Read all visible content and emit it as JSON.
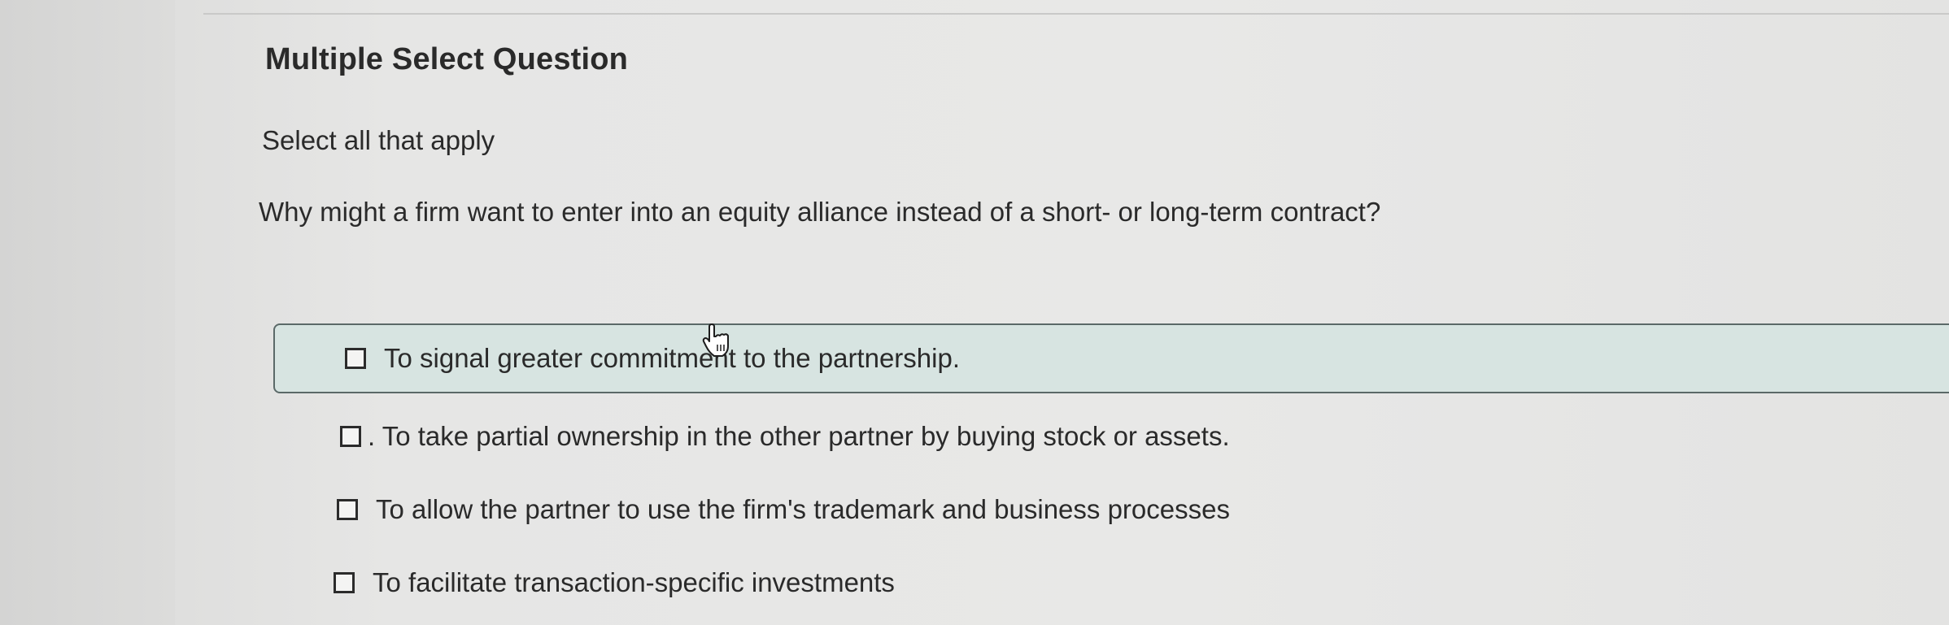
{
  "header": {
    "title": "Multiple Select Question"
  },
  "instruction": "Select all that apply",
  "question": "Why might a firm want to enter into an equity alliance instead of a short- or long-term contract?",
  "options": [
    {
      "label": "To signal greater commitment to the partnership.",
      "checked": false,
      "hovered": true
    },
    {
      "label": ". To take partial ownership in the other partner by buying stock or assets.",
      "checked": false,
      "hovered": false
    },
    {
      "label": "To allow the partner to use the firm's trademark and business processes",
      "checked": false,
      "hovered": false
    },
    {
      "label": "To facilitate transaction-specific investments",
      "checked": false,
      "hovered": false
    }
  ],
  "colors": {
    "highlight_bg": "#d7e4e1",
    "highlight_border": "#5b6968",
    "text": "#2a2a2a"
  },
  "icons": {
    "cursor": "hand-pointer-icon",
    "checkbox": "checkbox-unchecked-icon"
  }
}
